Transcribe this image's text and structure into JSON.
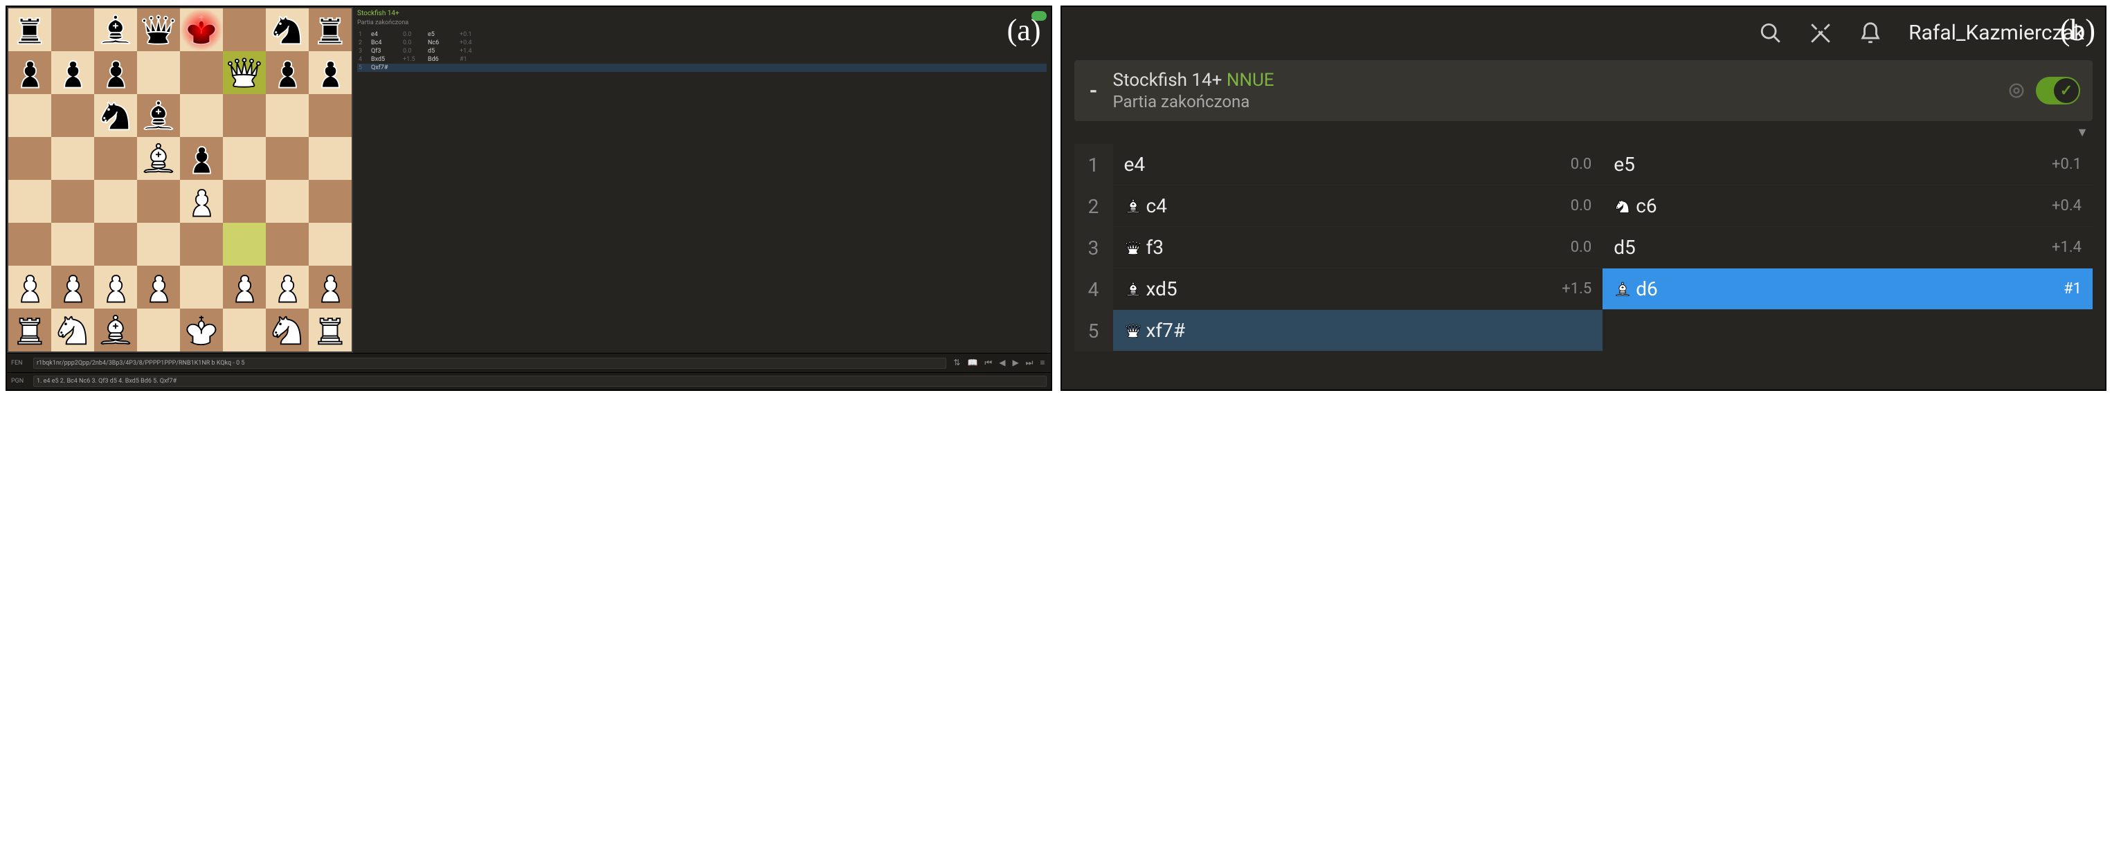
{
  "labels": {
    "a": "(a)",
    "b": "(b)"
  },
  "board": {
    "rows": [
      [
        "bR",
        "",
        "bB",
        "bQ",
        "bK",
        "",
        "bN",
        "bR"
      ],
      [
        "bP",
        "bP",
        "bP",
        "",
        "",
        "wQ",
        "bP",
        "bP"
      ],
      [
        "",
        "",
        "bN",
        "bB",
        "",
        "",
        "",
        ""
      ],
      [
        "",
        "",
        "",
        "wB",
        "bP",
        "",
        "",
        ""
      ],
      [
        "",
        "",
        "",
        "",
        "wP",
        "",
        "",
        ""
      ],
      [
        "",
        "",
        "",
        "",
        "",
        "",
        "",
        ""
      ],
      [
        "wP",
        "wP",
        "wP",
        "wP",
        "",
        "wP",
        "wP",
        "wP"
      ],
      [
        "wR",
        "wN",
        "wB",
        "",
        "wK",
        "",
        "wN",
        "wR"
      ]
    ],
    "highlight_from": "f3",
    "highlight_to": "f7",
    "check_square": "e8"
  },
  "mini": {
    "engine": "Stockfish 14+",
    "status": "Partia zakończona",
    "moves": [
      {
        "n": "1",
        "w": "e4",
        "we": "0.0",
        "b": "e5",
        "be": "+0.1"
      },
      {
        "n": "2",
        "w": "Bc4",
        "we": "0.0",
        "b": "Nc6",
        "be": "+0.4"
      },
      {
        "n": "3",
        "w": "Qf3",
        "we": "0.0",
        "b": "d5",
        "be": "+1.4"
      },
      {
        "n": "4",
        "w": "Bxd5",
        "we": "+1.5",
        "b": "Bd6",
        "be": "#1"
      },
      {
        "n": "5",
        "w": "Qxf7#",
        "we": "",
        "b": "",
        "be": ""
      }
    ],
    "selected_row": 4
  },
  "fen_label": "FEN",
  "fen": "r1bqk1nr/ppp2Qpp/2nb4/3Bp3/4P3/8/PPPP1PPP/RNB1K1NR b KQkq - 0 5",
  "pgn_label": "PGN",
  "pgn": "1. e4 e5 2. Bc4 Nc6 3. Qf3 d5 4. Bxd5 Bd6 5. Qxf7#",
  "controls": [
    "flip",
    "book",
    "first",
    "prev",
    "next",
    "last",
    "menu"
  ],
  "topbar": {
    "user": "Rafal_Kazmierczak"
  },
  "engine": {
    "eval": "-",
    "name": "Stockfish 14+",
    "nnue": "NNUE",
    "status": "Partia zakończona",
    "enabled": true
  },
  "collapse_glyph": "▼",
  "moves": [
    {
      "n": "1",
      "w": {
        "t": "e4"
      },
      "we": "0.0",
      "b": {
        "t": "e5"
      },
      "be": "+0.1"
    },
    {
      "n": "2",
      "w": {
        "p": "B",
        "t": "c4"
      },
      "we": "0.0",
      "b": {
        "p": "N",
        "t": "c6"
      },
      "be": "+0.4"
    },
    {
      "n": "3",
      "w": {
        "p": "Q",
        "t": "f3"
      },
      "we": "0.0",
      "b": {
        "t": "d5"
      },
      "be": "+1.4"
    },
    {
      "n": "4",
      "w": {
        "p": "B",
        "t": "xd5"
      },
      "we": "+1.5",
      "b": {
        "p": "B",
        "t": "d6",
        "hl": "blue"
      },
      "be": "#1"
    },
    {
      "n": "5",
      "w": {
        "p": "Q",
        "t": "xf7#",
        "hl": "dark"
      },
      "we": "",
      "b": null,
      "be": ""
    }
  ]
}
